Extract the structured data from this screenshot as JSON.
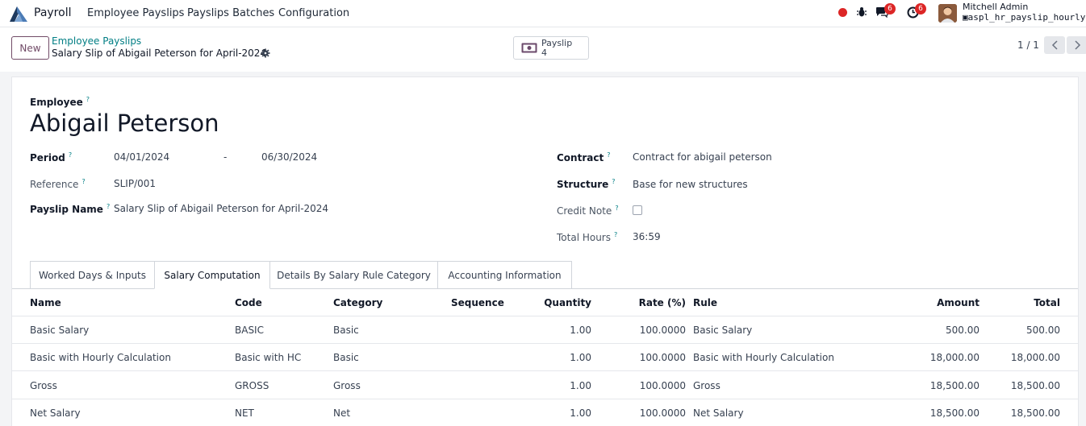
{
  "navbar": {
    "app_name": "Payroll",
    "menu": [
      "Employee Payslips",
      "Payslips Batches",
      "Configuration"
    ],
    "chat_count": "6",
    "activity_count": "6",
    "user_name": "Mitchell Admin",
    "database": "aspl_hr_payslip_hourly"
  },
  "control": {
    "new_label": "New",
    "breadcrumb_parent": "Employee Payslips",
    "breadcrumb_current": "Salary Slip of Abigail Peterson for April-2024",
    "smart_button": {
      "label": "Payslip",
      "count": "4"
    },
    "pager": "1 / 1"
  },
  "form": {
    "employee_label": "Employee",
    "employee_name": "Abigail Peterson",
    "period_label": "Period",
    "date_from": "04/01/2024",
    "date_sep": "-",
    "date_to": "06/30/2024",
    "reference_label": "Reference",
    "reference": "SLIP/001",
    "payslip_name_label": "Payslip Name",
    "payslip_name": "Salary Slip of Abigail Peterson for April-2024",
    "contract_label": "Contract",
    "contract": "Contract for abigail peterson",
    "structure_label": "Structure",
    "structure": "Base for new structures",
    "credit_note_label": "Credit Note",
    "total_hours_label": "Total Hours",
    "total_hours": "36:59",
    "tip": "?"
  },
  "tabs": [
    {
      "label": "Worked Days & Inputs",
      "active": false
    },
    {
      "label": "Salary Computation",
      "active": true
    },
    {
      "label": "Details By Salary Rule Category",
      "active": false
    },
    {
      "label": "Accounting Information",
      "active": false
    }
  ],
  "table": {
    "headers": [
      "Name",
      "Code",
      "Category",
      "Sequence",
      "Quantity",
      "Rate (%)",
      "Rule",
      "Amount",
      "Total"
    ],
    "rows": [
      {
        "name": "Basic Salary",
        "code": "BASIC",
        "category": "Basic",
        "quantity": "1.00",
        "rate": "100.0000",
        "rule": "Basic Salary",
        "amount": "500.00",
        "total": "500.00"
      },
      {
        "name": "Basic with Hourly Calculation",
        "code": "Basic with HC",
        "category": "Basic",
        "quantity": "1.00",
        "rate": "100.0000",
        "rule": "Basic with Hourly Calculation",
        "amount": "18,000.00",
        "total": "18,000.00"
      },
      {
        "name": "Gross",
        "code": "GROSS",
        "category": "Gross",
        "quantity": "1.00",
        "rate": "100.0000",
        "rule": "Gross",
        "amount": "18,500.00",
        "total": "18,500.00"
      },
      {
        "name": "Net Salary",
        "code": "NET",
        "category": "Net",
        "quantity": "1.00",
        "rate": "100.0000",
        "rule": "Net Salary",
        "amount": "18,500.00",
        "total": "18,500.00"
      }
    ]
  },
  "colors": {
    "brand": "#714b67",
    "link": "#017e84",
    "badge": "#dc2626"
  }
}
